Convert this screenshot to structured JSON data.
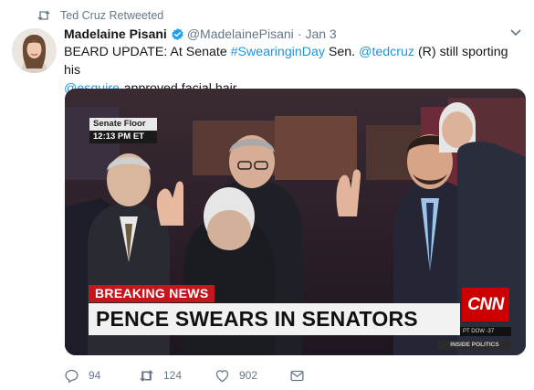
{
  "retweet_context": {
    "text": "Ted Cruz Retweeted"
  },
  "author": {
    "name": "Madelaine Pisani",
    "handle": "@MadelainePisani",
    "separator": "·",
    "date": "Jan 3",
    "verified": true
  },
  "tweet": {
    "prefix": "BEARD UPDATE: At Senate ",
    "hashtag": "#SwearinginDay",
    "middle": " Sen. ",
    "mention1": "@tedcruz",
    "suffix": " (R) still sporting his",
    "mention2": "@esquire",
    "ending": "-approved facial hair."
  },
  "media": {
    "locator_top": "Senate Floor",
    "locator_bottom": "12:13 PM ET",
    "breaking_label": "BREAKING NEWS",
    "headline": "PENCE SWEARS IN SENATORS",
    "network_logo": "CNN",
    "ticker": "PT  DOW  -37",
    "show_name": "INSIDE POLITICS"
  },
  "actions": {
    "replies": "94",
    "retweets": "124",
    "likes": "902"
  },
  "colors": {
    "link": "#1b95e0",
    "muted": "#657786",
    "retweet_green": "#17bf63",
    "breaking_red": "#c4161c",
    "cnn_red": "#cc0000"
  },
  "icons": [
    "retweet-icon",
    "verified-badge-icon",
    "chevron-down-icon",
    "reply-icon",
    "like-icon",
    "direct-message-icon"
  ]
}
